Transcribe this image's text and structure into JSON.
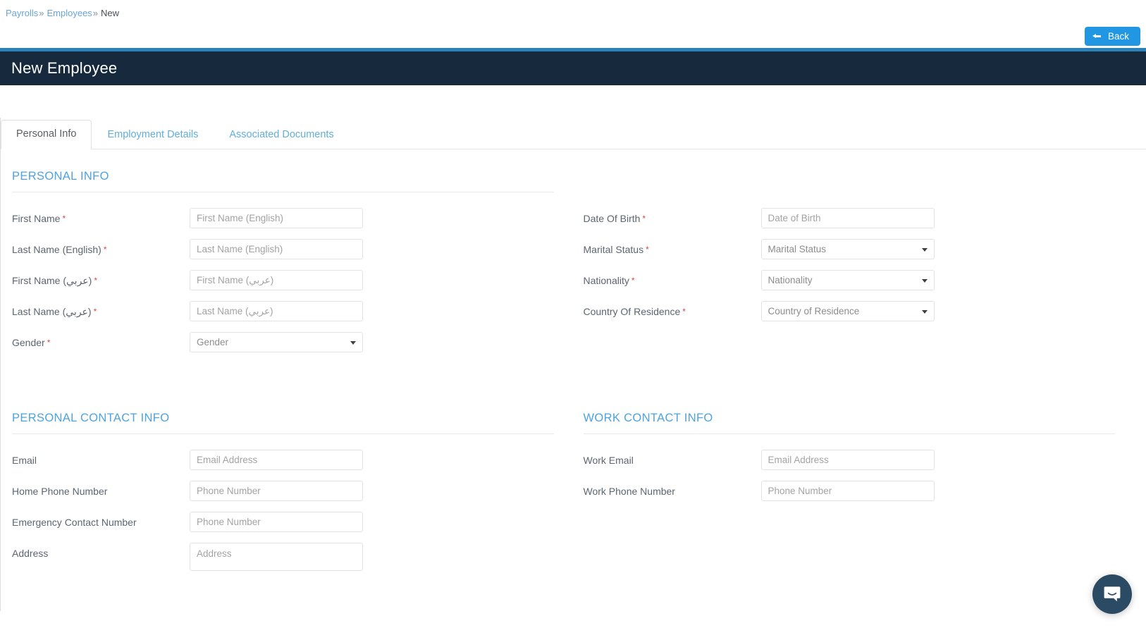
{
  "breadcrumb": {
    "items": [
      {
        "label": "Payrolls",
        "link": true
      },
      {
        "label": "Employees",
        "link": true
      },
      {
        "label": "New",
        "link": false
      }
    ],
    "separator": "»"
  },
  "toolbar": {
    "back_label": "Back",
    "back_icon": "arrow-left-icon"
  },
  "header": {
    "title": "New Employee",
    "accent_strip_color": "#2b82b8",
    "bar_color": "#16293d"
  },
  "tabs": [
    {
      "label": "Personal Info",
      "active": true
    },
    {
      "label": "Employment Details",
      "active": false
    },
    {
      "label": "Associated Documents",
      "active": false
    }
  ],
  "sections": {
    "personal_info": {
      "title": "PERSONAL INFO",
      "fields": [
        {
          "label": "First Name",
          "required": true,
          "type": "text",
          "placeholder": "First Name (English)",
          "value": ""
        },
        {
          "label": "Last Name (English)",
          "required": true,
          "type": "text",
          "placeholder": "Last Name (English)",
          "value": ""
        },
        {
          "label": "First Name (عربي)",
          "required": true,
          "type": "text",
          "placeholder": "First Name (عربي)",
          "value": ""
        },
        {
          "label": "Last Name (عربي)",
          "required": true,
          "type": "text",
          "placeholder": "Last Name (عربي)",
          "value": ""
        },
        {
          "label": "Gender",
          "required": true,
          "type": "select",
          "placeholder": "Gender",
          "value": "Gender"
        }
      ]
    },
    "personal_details": {
      "fields": [
        {
          "label": "Date Of Birth",
          "required": true,
          "type": "text",
          "placeholder": "Date of Birth",
          "value": ""
        },
        {
          "label": "Marital Status",
          "required": true,
          "type": "select",
          "placeholder": "Marital Status",
          "value": "Marital Status"
        },
        {
          "label": "Nationality",
          "required": true,
          "type": "select",
          "placeholder": "Nationality",
          "value": "Nationality"
        },
        {
          "label": "Country Of Residence",
          "required": true,
          "type": "select",
          "placeholder": "Country of Residence",
          "value": "Country of Residence"
        }
      ]
    },
    "personal_contact_info": {
      "title": "PERSONAL CONTACT INFO",
      "fields": [
        {
          "label": "Email",
          "required": false,
          "type": "text",
          "placeholder": "Email Address",
          "value": ""
        },
        {
          "label": "Home Phone Number",
          "required": false,
          "type": "text",
          "placeholder": "Phone Number",
          "value": ""
        },
        {
          "label": "Emergency Contact Number",
          "required": false,
          "type": "text",
          "placeholder": "Phone Number",
          "value": ""
        },
        {
          "label": "Address",
          "required": false,
          "type": "textarea",
          "placeholder": "Address",
          "value": ""
        }
      ]
    },
    "work_contact_info": {
      "title": "WORK CONTACT INFO",
      "fields": [
        {
          "label": "Work Email",
          "required": false,
          "type": "text",
          "placeholder": "Email Address",
          "value": ""
        },
        {
          "label": "Work Phone Number",
          "required": false,
          "type": "text",
          "placeholder": "Phone Number",
          "value": ""
        }
      ]
    }
  },
  "chat": {
    "icon": "chat-bubble-smile-icon",
    "color": "#2b4a63"
  }
}
